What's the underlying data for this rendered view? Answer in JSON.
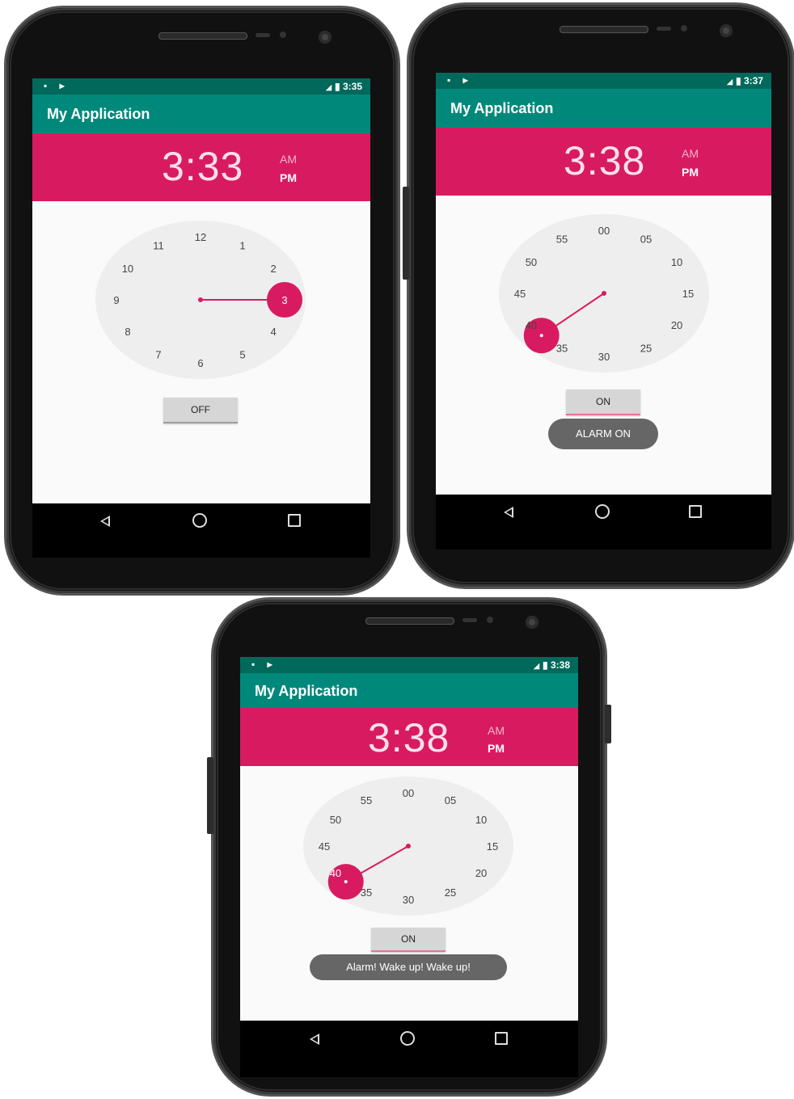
{
  "phones": [
    {
      "status_time": "3:35",
      "app_title": "My Application",
      "clock_time": "3:33",
      "am_label": "AM",
      "pm_label": "PM",
      "dial_mode": "hours",
      "dial_numbers": [
        "12",
        "1",
        "2",
        "3",
        "4",
        "5",
        "6",
        "7",
        "8",
        "9",
        "10",
        "11"
      ],
      "selected_value": "3",
      "toggle_label": "OFF",
      "toast_text": ""
    },
    {
      "status_time": "3:37",
      "app_title": "My Application",
      "clock_time": "3:38",
      "am_label": "AM",
      "pm_label": "PM",
      "dial_mode": "minutes",
      "dial_numbers": [
        "00",
        "05",
        "10",
        "15",
        "20",
        "25",
        "30",
        "35",
        "40",
        "45",
        "50",
        "55"
      ],
      "selected_value": "38",
      "toggle_label": "ON",
      "toast_text": "ALARM ON"
    },
    {
      "status_time": "3:38",
      "app_title": "My Application",
      "clock_time": "3:38",
      "am_label": "AM",
      "pm_label": "PM",
      "dial_mode": "minutes",
      "dial_numbers": [
        "00",
        "05",
        "10",
        "15",
        "20",
        "25",
        "30",
        "35",
        "40",
        "45",
        "50",
        "55"
      ],
      "selected_value": "38",
      "toggle_label": "ON",
      "toast_text": "Alarm! Wake up! Wake up!"
    }
  ],
  "colors": {
    "accent": "#d81b60",
    "toolbar": "#00897b",
    "statusbar": "#00695c"
  }
}
